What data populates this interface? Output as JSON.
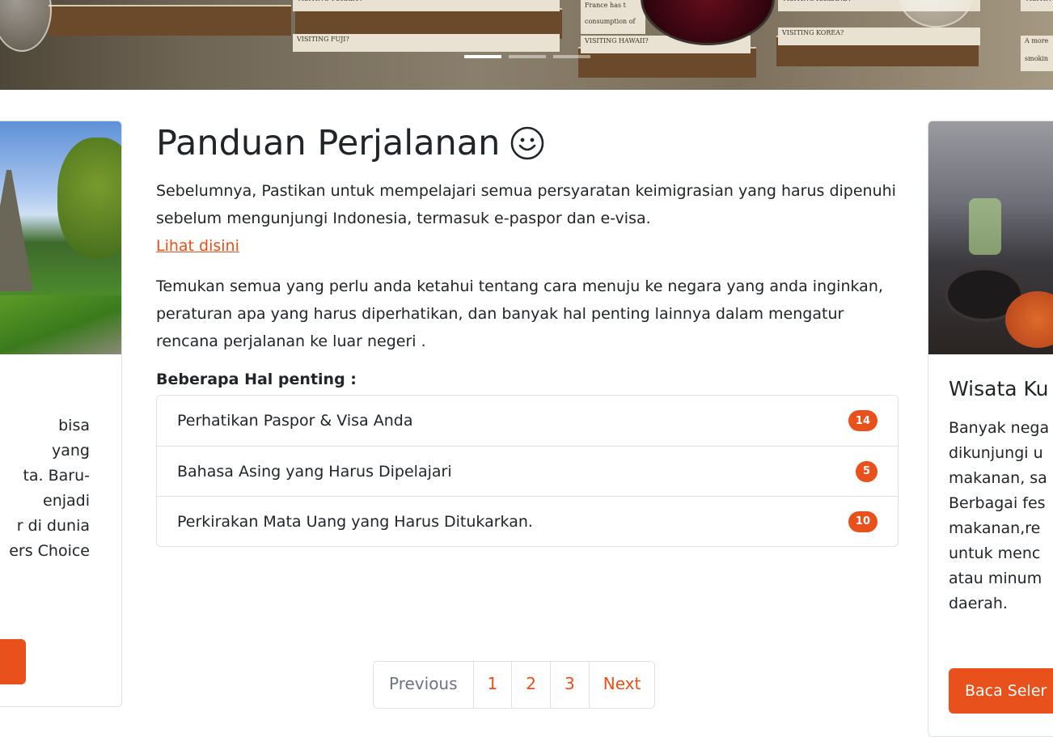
{
  "hero": {
    "slide_texts": [
      "VISITING TURKEY?",
      "VISITING FUJI?",
      "VISITING HAWAII?",
      "VISITING ICELAND?",
      "VISITING KOREA?",
      "VISITING",
      "France has t",
      "consumption of",
      "A more",
      "smokin"
    ],
    "indicator_count": 3,
    "active_indicator": 0
  },
  "main": {
    "title": "Panduan Perjalanan",
    "intro": "Sebelumnya, Pastikan untuk mempelajari semua persyaratan keimigrasian yang harus dipenuhi sebelum mengunjungi Indonesia, termasuk e-paspor dan e-visa.",
    "intro_link": "Lihat disini",
    "paragraph2": "Temukan semua yang perlu anda ketahui tentang cara menuju ke negara yang anda inginkan, peraturan apa yang harus diperhatikan, dan banyak hal penting lainnya dalam mengatur rencana perjalanan ke luar negeri .",
    "subheading": "Beberapa Hal penting :",
    "items": [
      {
        "label": "Perhatikan Paspor & Visa Anda",
        "badge": "14"
      },
      {
        "label": "Bahasa Asing yang Harus Dipelajari",
        "badge": "5"
      },
      {
        "label": "Perkirakan Mata Uang yang Harus Ditukarkan.",
        "badge": "10"
      }
    ]
  },
  "left_card": {
    "text_lines": [
      "bisa",
      "yang",
      "ta. Baru-",
      "enjadi",
      "r di dunia",
      "ers Choice"
    ]
  },
  "right_card": {
    "title": "Wisata Ku",
    "text_lines": [
      "Banyak nega",
      "dikunjungi u",
      "makanan, sa",
      "Berbagai fes",
      "makanan,re",
      "untuk menc",
      "atau minum",
      "daerah."
    ],
    "button_label": "Baca Seler"
  },
  "pagination": {
    "previous": "Previous",
    "pages": [
      "1",
      "2",
      "3"
    ],
    "next": "Next"
  },
  "colors": {
    "accent": "#e8501c",
    "border": "#dee2e6",
    "text": "#212529",
    "muted": "#6c757d"
  }
}
